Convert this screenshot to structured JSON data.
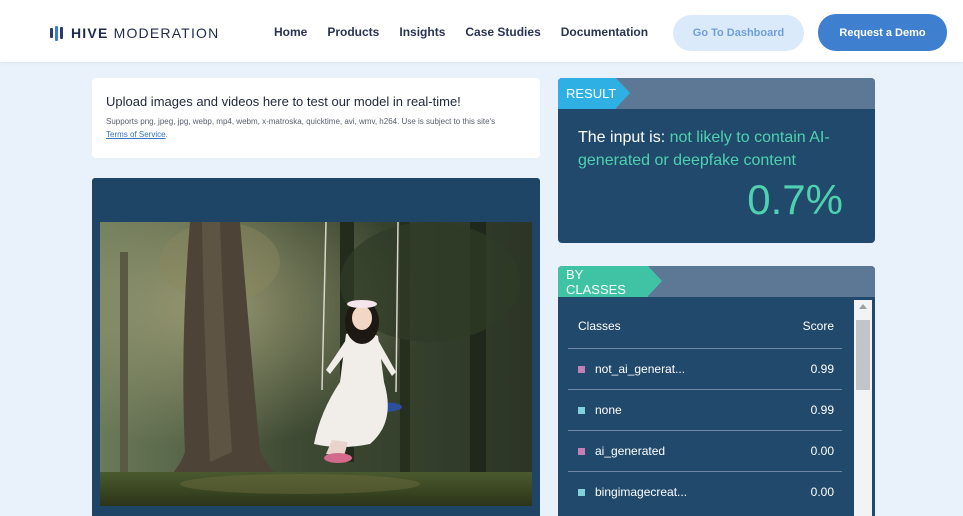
{
  "brand": {
    "bold": "HIVE",
    "light": "MODERATION"
  },
  "nav": {
    "links": [
      "Home",
      "Products",
      "Insights",
      "Case Studies",
      "Documentation"
    ],
    "dashboard_button": "Go To Dashboard",
    "demo_button": "Request a Demo"
  },
  "upload": {
    "title": "Upload images and videos here to test our model in real-time!",
    "supports": "Supports png, jpeg, jpg, webp, mp4, webm, x-matroska, quicktime, avi, wmv, h264. Use is subject to this site's",
    "terms_link": "Terms of Service",
    "terms_suffix": "."
  },
  "media": {
    "image_icon": "photo-of-girl-on-swing"
  },
  "result": {
    "tag": "RESULT",
    "prefix": "The input is:",
    "verdict": "not likely to contain AI-generated or deepfake content",
    "percent": "0.7%"
  },
  "classes": {
    "tag": "BY CLASSES",
    "col_class": "Classes",
    "col_score": "Score",
    "rows": [
      {
        "name": "not_ai_generat...",
        "score": "0.99",
        "color": "#c77db8"
      },
      {
        "name": "none",
        "score": "0.99",
        "color": "#7fd2dc"
      },
      {
        "name": "ai_generated",
        "score": "0.00",
        "color": "#c77db8"
      },
      {
        "name": "bingimagecreat...",
        "score": "0.00",
        "color": "#7fd2dc"
      }
    ]
  },
  "colors": {
    "accent_blue": "#3e7fd0",
    "panel_navy": "#20496b",
    "result_teal": "#4fd1b0",
    "result_tag": "#2fb0e4",
    "classes_tag": "#40c3a4"
  }
}
